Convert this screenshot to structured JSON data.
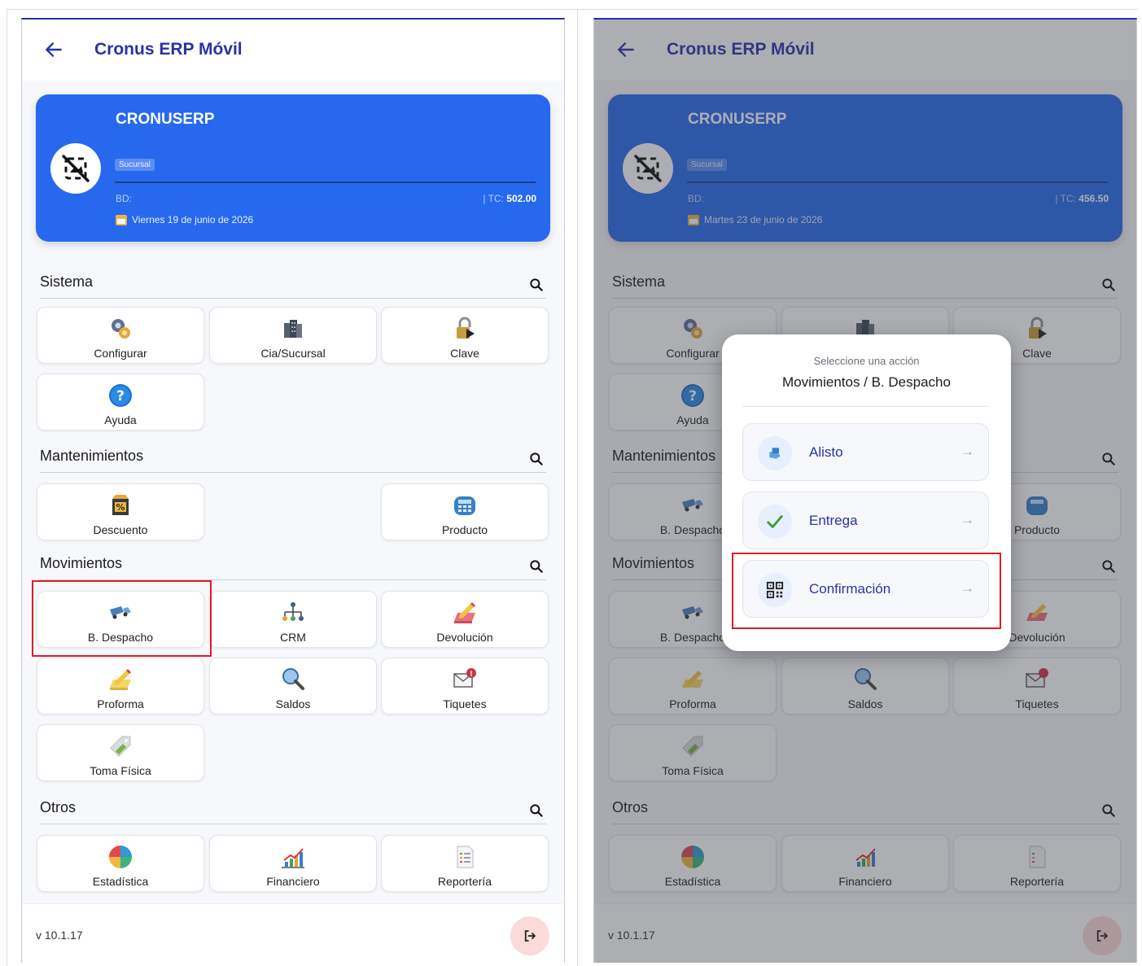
{
  "app": {
    "title": "Cronus ERP Móvil",
    "version": "v 10.1.17"
  },
  "left": {
    "company": "CRONUSERP",
    "badge": "Sucursal",
    "bd_label": "BD:",
    "tc_label": "| TC:",
    "tc_value": "502.00",
    "date": "Viernes 19 de junio de 2026"
  },
  "right": {
    "company": "CRONUSERP",
    "badge": "Sucursal",
    "bd_label": "BD:",
    "tc_label": "| TC:",
    "tc_value": "456.50",
    "date": "Martes 23 de junio de 2026"
  },
  "sections": {
    "sistema": {
      "title": "Sistema",
      "items": [
        "Configurar",
        "Cia/Sucursal",
        "Clave",
        "Ayuda"
      ]
    },
    "mantenimientos": {
      "title": "Mantenimientos",
      "items": [
        "Descuento",
        "B. Despacho",
        "Producto"
      ]
    },
    "movimientos": {
      "title": "Movimientos",
      "items": [
        "B. Despacho",
        "CRM",
        "Devolución",
        "Proforma",
        "Saldos",
        "Tiquetes",
        "Toma Física"
      ]
    },
    "otros": {
      "title": "Otros",
      "items": [
        "Estadística",
        "Financiero",
        "Reportería"
      ]
    }
  },
  "dialog": {
    "subtitle": "Seleccione una acción",
    "title": "Movimientos / B. Despacho",
    "actions": [
      "Alisto",
      "Entrega",
      "Confirmación"
    ],
    "arrow": "→"
  },
  "colors": {
    "primary": "#2a32a6",
    "card": "#2769ee",
    "highlight": "#e01b24"
  }
}
